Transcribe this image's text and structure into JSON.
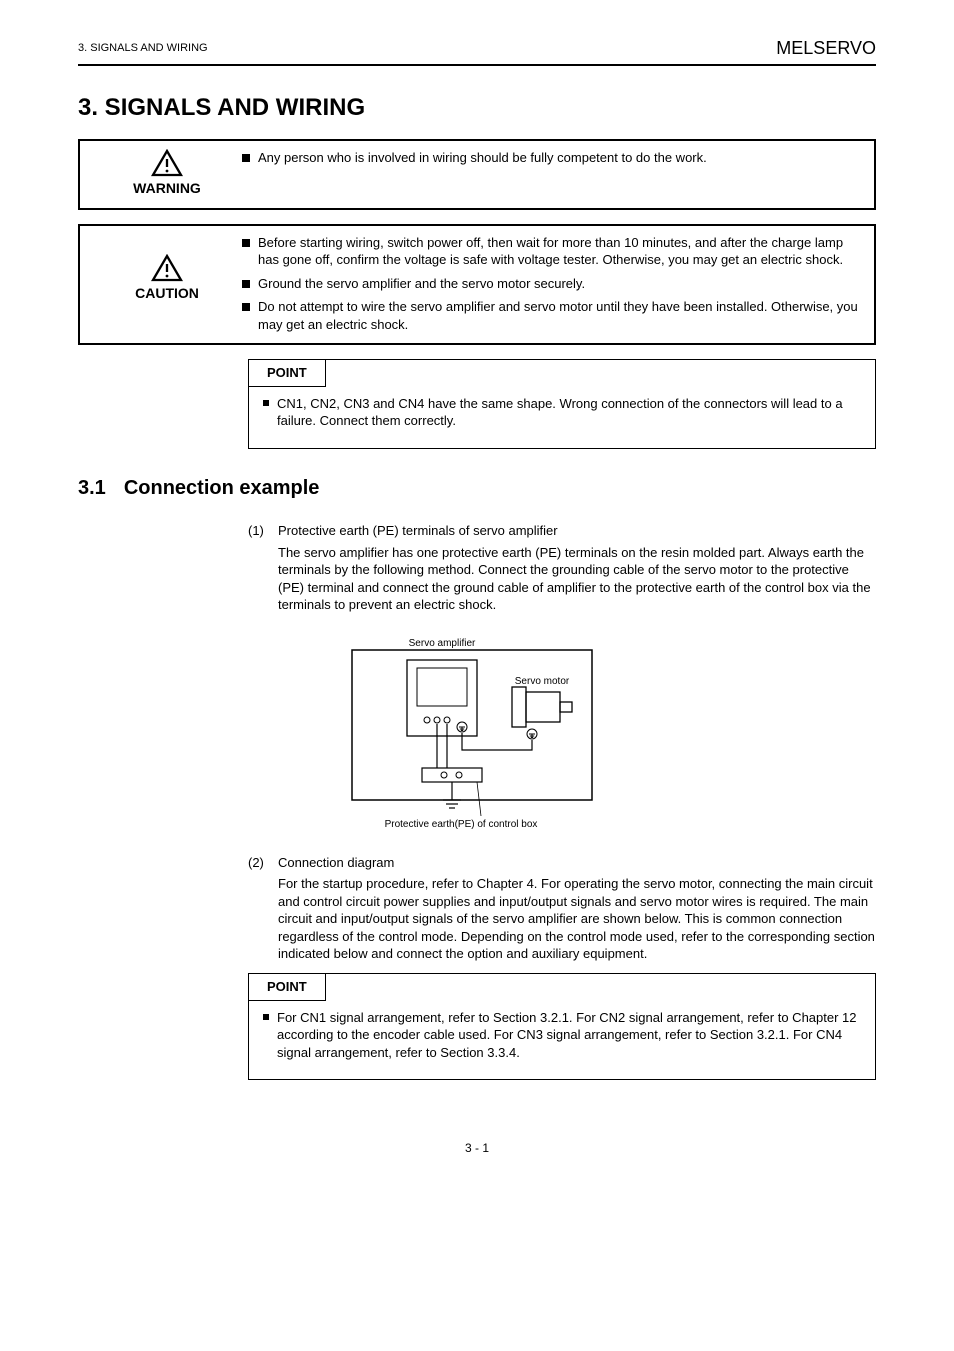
{
  "header": {
    "left": "3. SIGNALS AND WIRING",
    "right": "MELSERVO"
  },
  "section_heading": "3.  SIGNALS AND WIRING",
  "warning_callout": {
    "word": "WARNING",
    "items": [
      "Any person who is involved in wiring should be fully competent to do the work."
    ]
  },
  "caution_callout": {
    "word": "CAUTION",
    "items": [
      "Before starting wiring, switch power off, then wait for more than 10 minutes, and after the charge lamp has gone off, confirm the voltage is safe with voltage tester. Otherwise, you may get an electric shock.",
      "Ground the servo amplifier and the servo motor securely.",
      "Do not attempt to wire the servo amplifier and servo motor until they have been installed. Otherwise, you may get an electric shock."
    ]
  },
  "point": {
    "label": "POINT",
    "items": [
      "CN1, CN2, CN3 and CN4 have the same shape. Wrong connection of the connectors will lead to a failure. Connect them correctly."
    ]
  },
  "subsection_1": {
    "num": "3.1",
    "title": "Connection example",
    "items": [
      {
        "key": "(1)",
        "title": "Protective earth (PE) terminals of servo amplifier",
        "body": "The servo amplifier has one protective earth (PE) terminals on the resin molded part. Always earth the terminals by the following method. Connect the grounding cable of the servo motor to the protective (PE) terminal and connect the ground cable of amplifier to the protective earth of the control box via the terminals to prevent an electric shock."
      },
      {
        "key": "(2)",
        "title": "Connection diagram",
        "body": "For the startup procedure, refer to Chapter 4. For operating the servo motor, connecting the main circuit and control circuit power supplies and input/output signals and servo motor wires is required. The main circuit and input/output signals of the servo amplifier are shown below. This is common connection regardless of the control mode. Depending on the control mode used, refer to the corresponding section indicated below and connect the option and auxiliary equipment."
      }
    ]
  },
  "diagram": {
    "amplifier_label": "Servo amplifier",
    "motor_label": "Servo motor",
    "pe_label": "Protective earth(PE) of control box"
  },
  "point2": {
    "label": "POINT",
    "items": [
      "For CN1 signal arrangement, refer to Section 3.2.1. For CN2 signal arrangement, refer to Chapter 12 according to the encoder cable used. For CN3 signal arrangement, refer to Section 3.2.1. For CN4 signal arrangement, refer to Section 3.3.4."
    ]
  },
  "pagenum": "3 - 1"
}
